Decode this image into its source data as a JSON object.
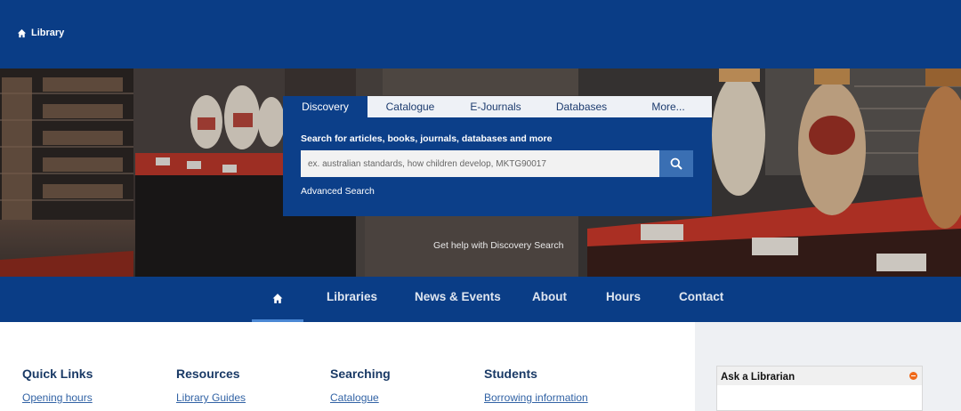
{
  "header": {
    "breadcrumb": "Library"
  },
  "search": {
    "tabs": [
      {
        "label": "Discovery",
        "active": true
      },
      {
        "label": "Catalogue",
        "active": false
      },
      {
        "label": "E-Journals",
        "active": false
      },
      {
        "label": "Databases",
        "active": false
      },
      {
        "label": "More...",
        "active": false
      }
    ],
    "heading": "Search for articles, books, journals, databases and more",
    "placeholder": "ex. australian standards, how children develop, MKTG90017",
    "value": "",
    "advanced": "Advanced Search",
    "help": "Get help with Discovery Search"
  },
  "nav": {
    "home_icon": "home-icon",
    "items": [
      "Libraries",
      "News & Events",
      "About",
      "Hours",
      "Contact"
    ]
  },
  "columns": [
    {
      "title": "Quick Links",
      "link": "Opening hours"
    },
    {
      "title": "Resources",
      "link": "Library Guides"
    },
    {
      "title": "Searching",
      "link": "Catalogue"
    },
    {
      "title": "Students",
      "link": "Borrowing information"
    }
  ],
  "sidebar": {
    "ask_title": "Ask a Librarian"
  },
  "colors": {
    "brand": "#0a3d86",
    "accent": "#3a6fb3",
    "link": "#3263a5"
  }
}
